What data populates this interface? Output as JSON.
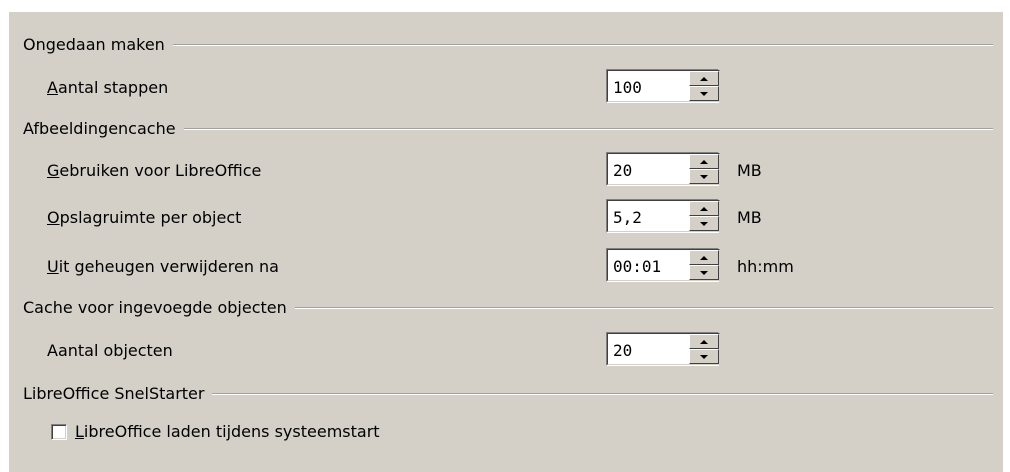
{
  "sections": {
    "undo": {
      "title": "Ongedaan maken",
      "steps_label": "Aantal stappen",
      "steps_value": "100"
    },
    "graphics_cache": {
      "title": "Afbeeldingencache",
      "use_label": "Gebruiken voor LibreOffice",
      "use_value": "20",
      "use_unit": "MB",
      "per_object_label": "Opslagruimte per object",
      "per_object_value": "5,2",
      "per_object_unit": "MB",
      "remove_label": "Uit geheugen verwijderen na",
      "remove_value": "00:01",
      "remove_unit": "hh:mm"
    },
    "object_cache": {
      "title": "Cache voor ingevoegde objecten",
      "count_label": "Aantal objecten",
      "count_value": "20"
    },
    "quickstarter": {
      "title": "LibreOffice SnelStarter",
      "checkbox_label": "LibreOffice laden tijdens systeemstart",
      "checked": false
    }
  }
}
